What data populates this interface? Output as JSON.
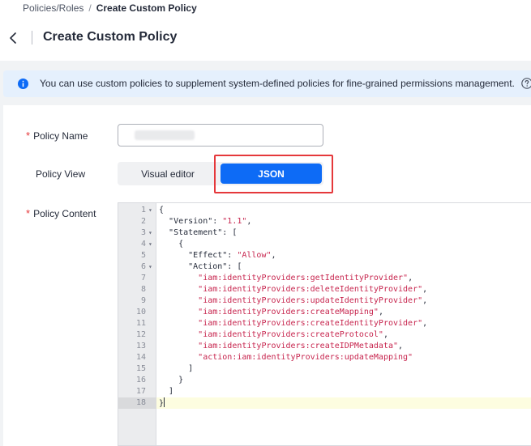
{
  "breadcrumb": {
    "parent": "Policies/Roles",
    "separator": "/",
    "current": "Create Custom Policy"
  },
  "header": {
    "title": "Create Custom Policy",
    "back_icon": "chevron-left-icon"
  },
  "banner": {
    "text": "You can use custom policies to supplement system-defined policies for fine-grained permissions management.",
    "info_icon": "info-icon",
    "help_icon": "question-circle-icon"
  },
  "form": {
    "policy_name": {
      "label": "Policy Name",
      "required_mark": "*",
      "value": ""
    },
    "policy_view": {
      "label": "Policy View",
      "options": [
        "Visual editor",
        "JSON"
      ],
      "selected": "JSON"
    },
    "policy_content": {
      "label": "Policy Content",
      "required_mark": "*"
    }
  },
  "editor": {
    "lines": [
      {
        "n": "1",
        "fold": true,
        "text": "{"
      },
      {
        "n": "2",
        "fold": false,
        "text": "  \"Version\": \"1.1\","
      },
      {
        "n": "3",
        "fold": true,
        "text": "  \"Statement\": ["
      },
      {
        "n": "4",
        "fold": true,
        "text": "    {"
      },
      {
        "n": "5",
        "fold": false,
        "text": "      \"Effect\": \"Allow\","
      },
      {
        "n": "6",
        "fold": true,
        "text": "      \"Action\": ["
      },
      {
        "n": "7",
        "fold": false,
        "text": "        \"iam:identityProviders:getIdentityProvider\","
      },
      {
        "n": "8",
        "fold": false,
        "text": "        \"iam:identityProviders:deleteIdentityProvider\","
      },
      {
        "n": "9",
        "fold": false,
        "text": "        \"iam:identityProviders:updateIdentityProvider\","
      },
      {
        "n": "10",
        "fold": false,
        "text": "        \"iam:identityProviders:createMapping\","
      },
      {
        "n": "11",
        "fold": false,
        "text": "        \"iam:identityProviders:createIdentityProvider\","
      },
      {
        "n": "12",
        "fold": false,
        "text": "        \"iam:identityProviders:createProtocol\","
      },
      {
        "n": "13",
        "fold": false,
        "text": "        \"iam:identityProviders:createIDPMetadata\","
      },
      {
        "n": "14",
        "fold": false,
        "text": "        \"action:iam:identityProviders:updateMapping\""
      },
      {
        "n": "15",
        "fold": false,
        "text": "      ]"
      },
      {
        "n": "16",
        "fold": false,
        "text": "    }"
      },
      {
        "n": "17",
        "fold": false,
        "text": "  ]"
      },
      {
        "n": "18",
        "fold": false,
        "text": "}",
        "active": true
      }
    ]
  },
  "colors": {
    "accent": "#0d6bf6",
    "required": "#e5383b",
    "string": "#c7254e",
    "highlight_box": "#e5383b"
  }
}
